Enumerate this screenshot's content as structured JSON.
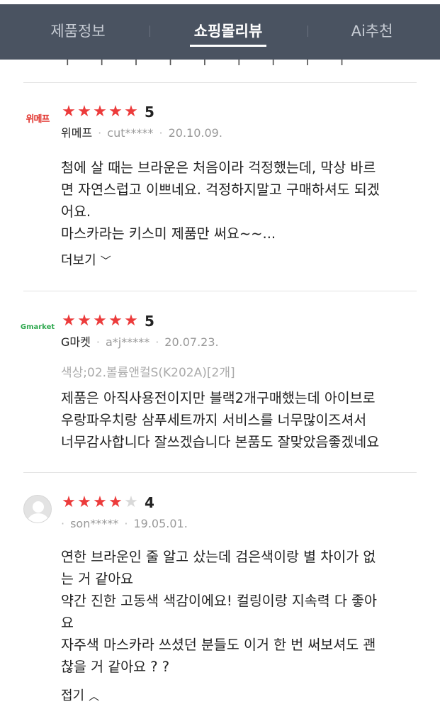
{
  "tabs": [
    {
      "label": "제품정보",
      "active": false
    },
    {
      "label": "쇼핑몰리뷰",
      "active": true
    },
    {
      "label": "Ai추천",
      "active": false
    }
  ],
  "reviews": [
    {
      "logo_text": "위메프",
      "rating": 5,
      "score_label": "5",
      "mall": "위메프",
      "user": "cut*****",
      "date": "20.10.09.",
      "body": "첨에 살 때는 브라운은 처음이라 걱정했는데, 막상 바르\n면 자연스럽고 이쁘네요. 걱정하지말고 구매하셔도 되겠\n어요.\n마스카라는 키스미 제품만 써요~~...",
      "more_label": "더보기",
      "more_icon": "chevron-down-icon"
    },
    {
      "logo_text": "Gmarket",
      "rating": 5,
      "score_label": "5",
      "mall": "G마켓",
      "user": "a*j*****",
      "date": "20.07.23.",
      "option": "색상;02.볼륨앤컬S(K202A)[2개]",
      "body": "제품은 아직사용전이지만 블랙2개구매했는데 아이브로\n우랑파우치랑 삼푸세트까지 서비스를 너무많이즈셔서\n너무감사합니다 잘쓰겠습니다 본품도 잘맞았음좋겠네요"
    },
    {
      "logo_icon": "user-avatar-icon",
      "rating": 4,
      "score_label": "4",
      "mall": "",
      "user": "son*****",
      "date": "19.05.01.",
      "body": "연한 브라운인 줄 알고 샀는데 검은색이랑 별 차이가 없\n는 거 같아요\n약간 진한 고동색 색감이에요! 컬링이랑 지속력 다 좋아\n요\n자주색 마스카라 쓰셨던 분들도 이거 한 번 써보셔도 괜\n찮을 거 같아요 ? ?",
      "more_label": "접기",
      "more_icon": "chevron-up-icon"
    }
  ],
  "colors": {
    "header_bg": "#4a5361",
    "star_on": "#ec3b3b",
    "star_off": "#d9d9d9",
    "gmarket_green": "#2fa84f",
    "wemakeprice_red": "#e1302a"
  }
}
